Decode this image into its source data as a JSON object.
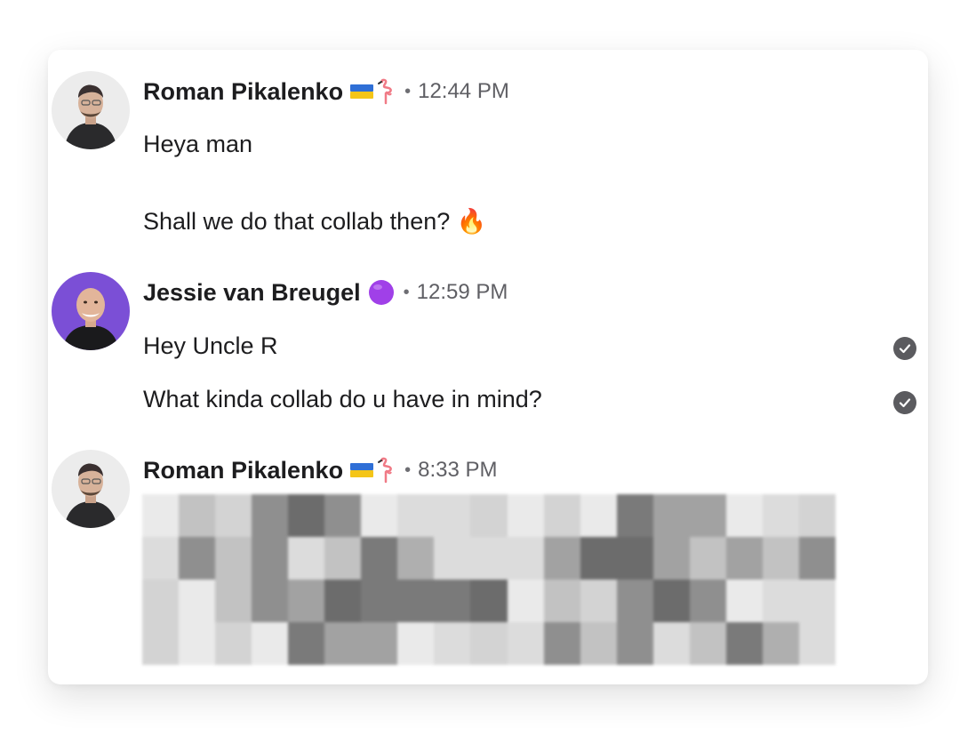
{
  "messages": [
    {
      "author": "Roman Pikalenko",
      "badges": [
        "flag-ukraine-icon",
        "flamingo-icon"
      ],
      "separator": "•",
      "time": "12:44 PM",
      "lines": [
        "Heya man",
        "Shall we do that collab then? 🔥"
      ]
    },
    {
      "author": "Jessie van Breugel",
      "badges": [
        "purple-circle-icon"
      ],
      "separator": "•",
      "time": "12:59 PM",
      "lines": [
        "Hey Uncle R",
        "What kinda collab do u have in mind?"
      ],
      "read_receipts": [
        true,
        true
      ]
    },
    {
      "author": "Roman Pikalenko",
      "badges": [
        "flag-ukraine-icon",
        "flamingo-icon"
      ],
      "separator": "•",
      "time": "8:33 PM",
      "lines_redacted": true
    }
  ],
  "colors": {
    "name": "#1d1d1f",
    "time": "#5f5f64",
    "read_check": "#5b5b5f",
    "jessie_avatar_bg": "#7b4fd6",
    "roman_avatar_bg": "#ececec",
    "purple_badge": "#a040e8"
  }
}
